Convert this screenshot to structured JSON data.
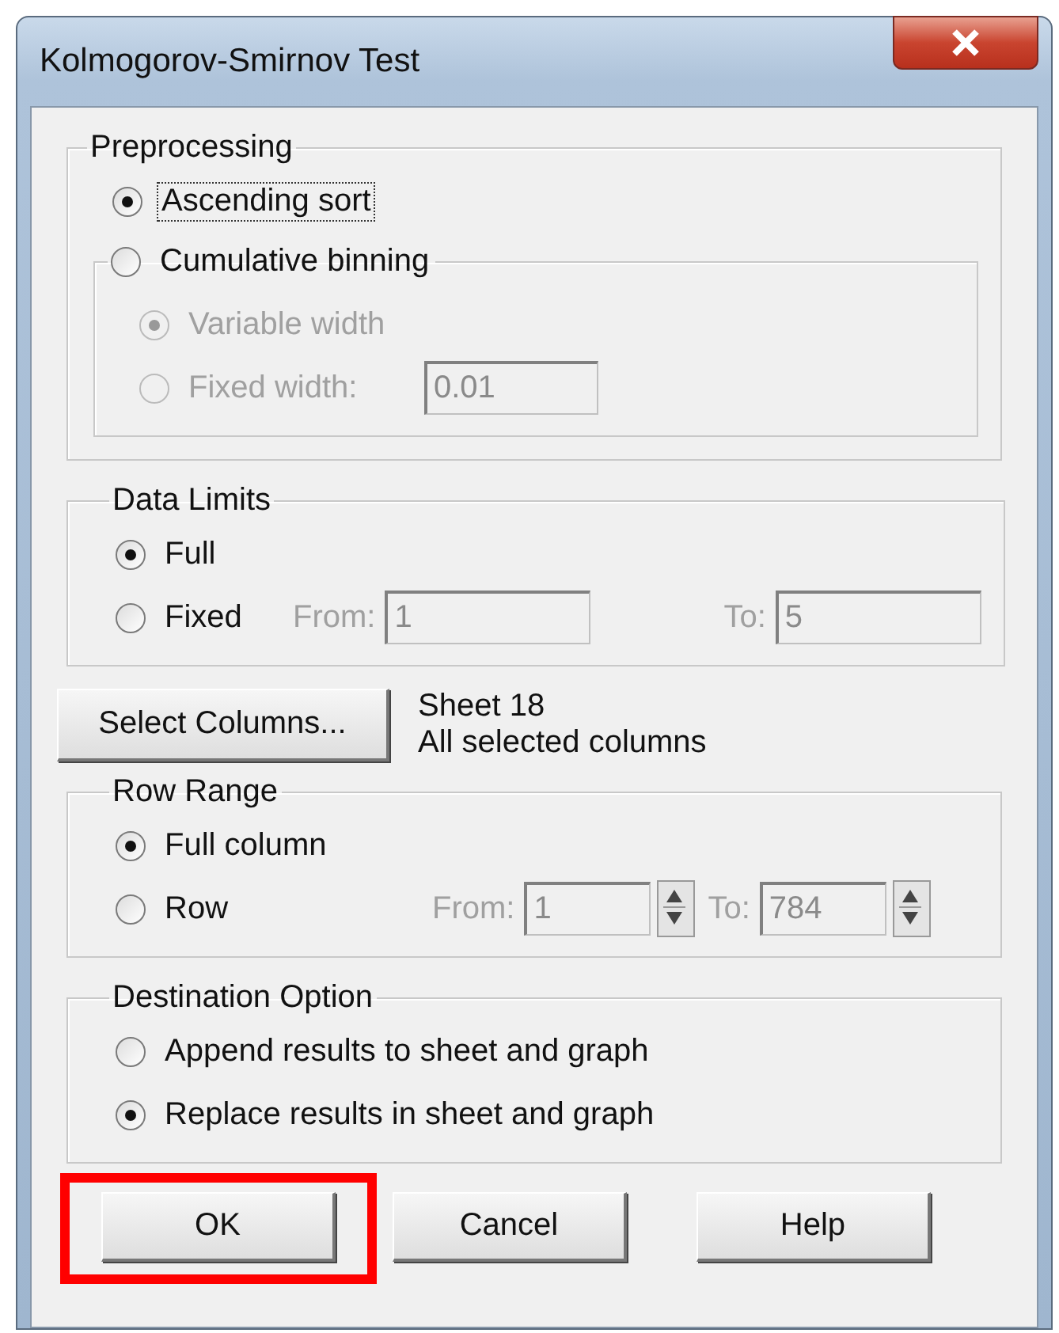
{
  "window": {
    "title": "Kolmogorov-Smirnov Test"
  },
  "preprocessing": {
    "title": "Preprocessing",
    "sort_option": {
      "label": "Ascending sort",
      "selected": true,
      "focused": true
    },
    "binning": {
      "label": "Cumulative binning",
      "selected": false,
      "options": [
        {
          "label": "Variable width",
          "selected": true,
          "disabled": true
        },
        {
          "label": "Fixed width:",
          "selected": false,
          "disabled": true
        }
      ],
      "width_field": {
        "value": "0.01",
        "disabled": true
      }
    }
  },
  "data_limits": {
    "title": "Data Limits",
    "options": [
      {
        "label": "Full",
        "selected": true
      },
      {
        "label": "Fixed",
        "selected": false
      }
    ],
    "from": {
      "label": "From:",
      "value": "1",
      "disabled": true
    },
    "to": {
      "label": "To:",
      "value": "5",
      "disabled": true
    }
  },
  "columns": {
    "button": "Select Columns...",
    "sheet": "Sheet 18",
    "info": "All selected columns"
  },
  "row_range": {
    "title": "Row Range",
    "options": [
      {
        "label": "Full column",
        "selected": true
      },
      {
        "label": "Row",
        "selected": false
      }
    ],
    "from": {
      "label": "From:",
      "value": "1",
      "disabled": true
    },
    "to": {
      "label": "To:",
      "value": "784",
      "disabled": true
    }
  },
  "destination": {
    "title": "Destination Option",
    "options": [
      {
        "label": "Append results to sheet and graph",
        "selected": false
      },
      {
        "label": "Replace results in sheet and graph",
        "selected": true
      }
    ]
  },
  "buttons": [
    {
      "label": "OK",
      "highlighted": true
    },
    {
      "label": "Cancel",
      "highlighted": false
    },
    {
      "label": "Help",
      "highlighted": false
    }
  ]
}
